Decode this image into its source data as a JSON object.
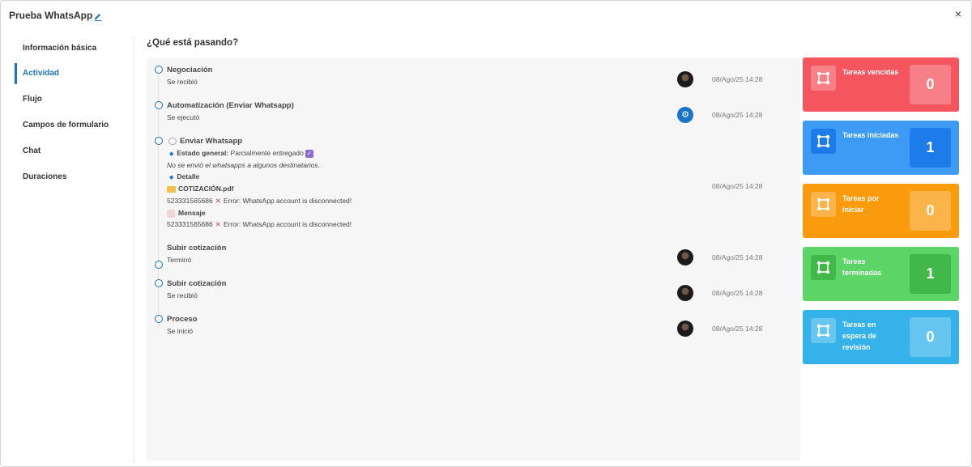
{
  "header": {
    "title": "Prueba WhatsApp",
    "close": "×"
  },
  "sidebar": {
    "items": [
      {
        "label": "Información básica"
      },
      {
        "label": "Actividad"
      },
      {
        "label": "Flujo"
      },
      {
        "label": "Campos de formulario"
      },
      {
        "label": "Chat"
      },
      {
        "label": "Duraciones"
      }
    ]
  },
  "main": {
    "heading": "¿Qué está pasando?",
    "events": [
      {
        "title": "Negociación",
        "sub": "Se recibió",
        "time": "08/Ago/25 14:28"
      },
      {
        "title": "Automatización (Enviar Whatsapp)",
        "sub": "Se ejecutó",
        "time": "08/Ago/25 14:28"
      },
      {
        "title": "Enviar Whatsapp",
        "estado_label": "Estado general:",
        "estado_value": "Parcialmente entregado",
        "note": "No se envió el whatsapps a algunos destinatarios.",
        "detalle": "Detalle",
        "file": "COTIZACIÓN.pdf",
        "error1": "523331565686",
        "error1_text": "Error: WhatsApp account is disconnected!",
        "mensaje": "Mensaje",
        "error2": "523331565686",
        "error2_text": "Error: WhatsApp account is disconnected!",
        "time": "08/Ago/25 14:28"
      },
      {
        "title": "Subir cotización",
        "sub": "Terminó",
        "time": "08/Ago/25 14:28"
      },
      {
        "title": "Subir cotización",
        "sub": "Se recibió",
        "time": "08/Ago/25 14:28"
      },
      {
        "title": "Proceso",
        "sub": "Se inició",
        "time": "08/Ago/25 14:28"
      }
    ]
  },
  "cards": [
    {
      "label": "Tareas vencidas",
      "count": "0",
      "color": "#f5555f"
    },
    {
      "label": "Tareas iniciadas",
      "count": "1",
      "color": "#3d9bf5"
    },
    {
      "label": "Tareas por iniciar",
      "count": "0",
      "color": "#f99b0c"
    },
    {
      "label": "Tareas terminadas",
      "count": "1",
      "color": "#5dd466"
    },
    {
      "label": "Tareas en espera de revisión",
      "count": "0",
      "color": "#36b2ea"
    }
  ]
}
